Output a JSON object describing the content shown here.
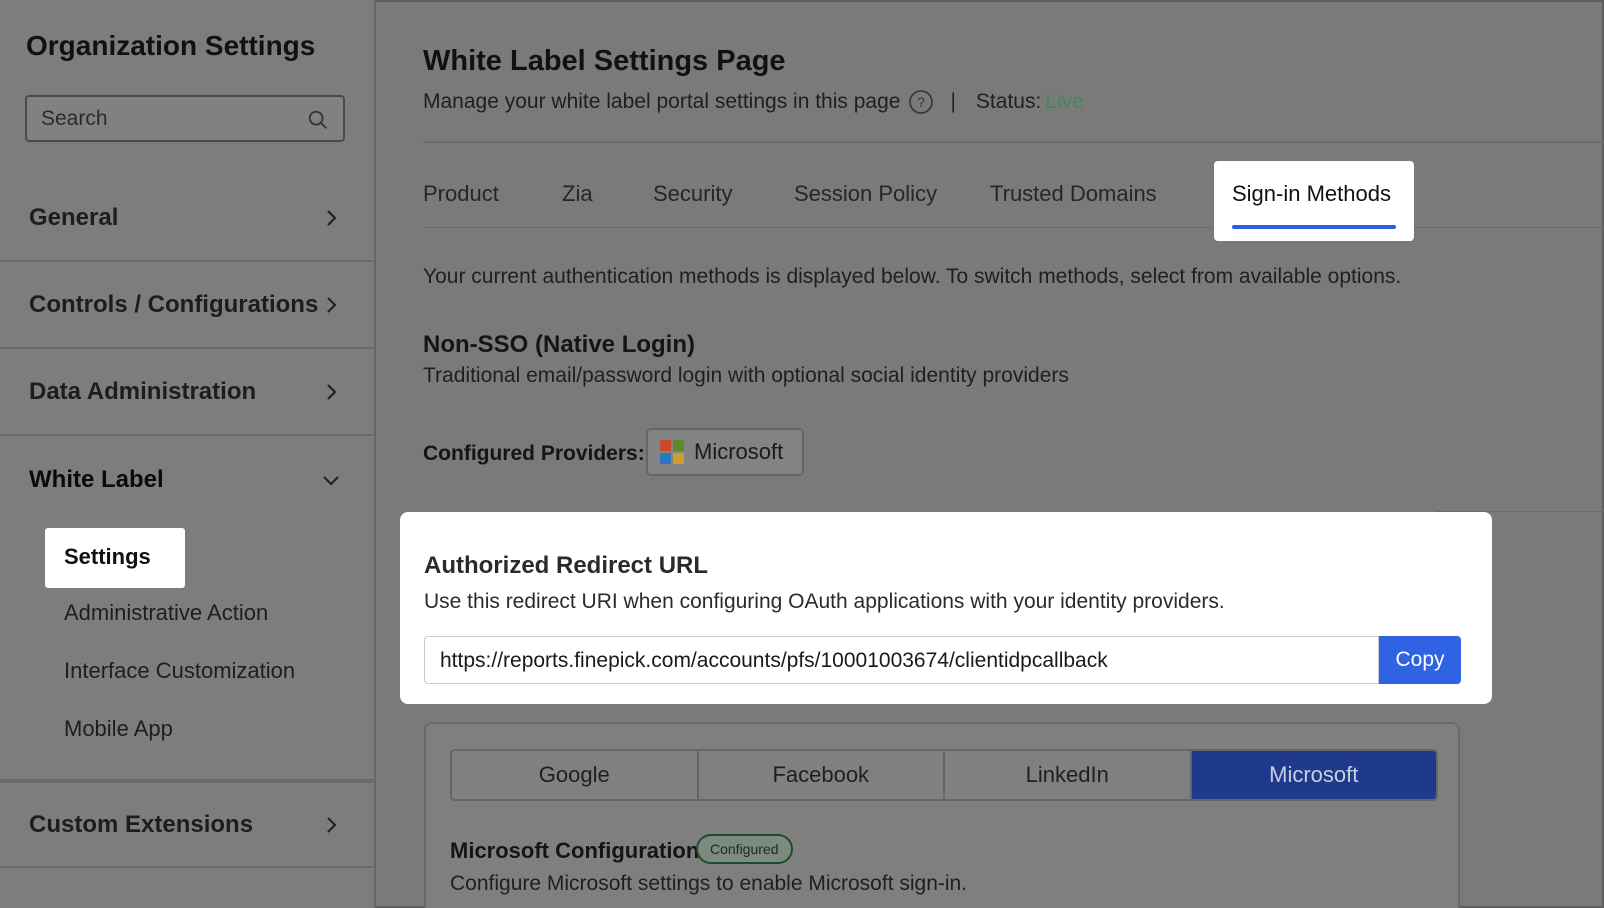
{
  "sidebar": {
    "title": "Organization Settings",
    "search_placeholder": "Search",
    "sections": [
      {
        "label": "General",
        "icon": "chevron-right-icon"
      },
      {
        "label": "Controls / Configurations",
        "icon": "chevron-right-icon"
      },
      {
        "label": "Data Administration",
        "icon": "chevron-right-icon"
      },
      {
        "label": "White Label",
        "icon": "chevron-down-icon",
        "expanded": true
      },
      {
        "label": "Custom Extensions",
        "icon": "chevron-right-icon"
      }
    ],
    "white_label_items": [
      {
        "label": "Settings",
        "selected": true
      },
      {
        "label": "Administrative Action"
      },
      {
        "label": "Interface Customization"
      },
      {
        "label": "Mobile App"
      }
    ]
  },
  "header": {
    "title": "White Label Settings Page",
    "subtitle": "Manage your white label portal settings in this page",
    "separator": "|",
    "status_label": "Status:",
    "status_value": "Live",
    "status_color": "#3d8a5a"
  },
  "tabs": [
    {
      "label": "Product"
    },
    {
      "label": "Zia"
    },
    {
      "label": "Security"
    },
    {
      "label": "Session Policy"
    },
    {
      "label": "Trusted Domains"
    },
    {
      "label": "Sign-in Methods",
      "active": true
    }
  ],
  "content": {
    "intro": "Your current authentication methods is displayed below. To switch methods, select from available options.",
    "method_title": "Non-SSO (Native Login)",
    "method_desc": "Traditional email/password login with optional social identity providers",
    "providers_label": "Configured Providers:",
    "configured_provider": "Microsoft"
  },
  "redirect": {
    "title": "Authorized Redirect URL",
    "description": "Use this redirect URI when configuring OAuth applications with your identity providers.",
    "url": "https://reports.finepick.com/accounts/pfs/10001003674/clientidpcallback",
    "copy_label": "Copy",
    "accent_color": "#2f63e4"
  },
  "provider_tabs": {
    "options": [
      "Google",
      "Facebook",
      "LinkedIn",
      "Microsoft"
    ],
    "selected": "Microsoft",
    "config_title": "Microsoft Configuration",
    "badge": "Configured",
    "config_desc": "Configure Microsoft settings to enable Microsoft sign-in."
  }
}
